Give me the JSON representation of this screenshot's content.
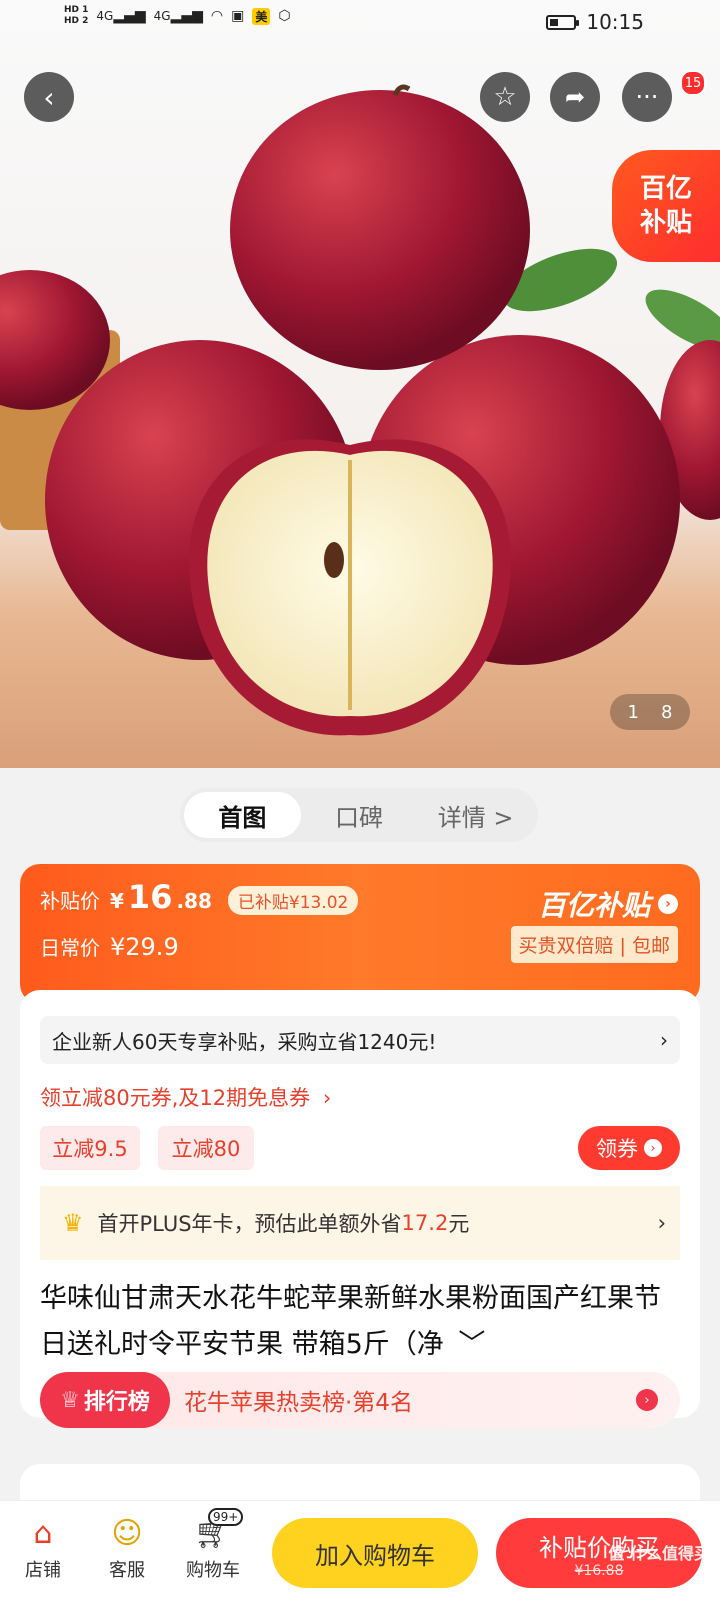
{
  "status_bar": {
    "time": "10:15",
    "hd1": "HD 1",
    "hd2": "HD 2",
    "net1": "4G",
    "net2": "4G",
    "app_badge": "美",
    "battery_level": 0.35
  },
  "hero": {
    "page_current": "1",
    "page_total": "8",
    "cart_count_badge": "15",
    "subsidy_tag_line1": "百亿",
    "subsidy_tag_line2": "补贴"
  },
  "tabs": [
    {
      "label": "首图",
      "active": true
    },
    {
      "label": "口碑",
      "active": false
    },
    {
      "label": "详情 >",
      "active": false
    }
  ],
  "price": {
    "subsidy_label": "补贴价",
    "currency": "¥",
    "subsidy_price_int": "16",
    "subsidy_price_dec": ".88",
    "saved_text": "已补贴¥13.02",
    "regular_label": "日常价",
    "regular_price": "¥29.9",
    "brand": "百亿补贴",
    "guarantee": "买贵双倍赔 | 包邮"
  },
  "promo": {
    "enterprise_banner": "企业新人60天专享补贴，采购立省1240元!",
    "coupon_line": "领立减80元券,及12期免息券",
    "chips": [
      "立减9.5",
      "立减80"
    ],
    "claim_button": "领券",
    "plus_text_prefix": "首开PLUS年卡，预估此单额外省",
    "plus_amount": "17.2",
    "plus_unit": "元"
  },
  "product": {
    "title": "华味仙甘肃天水花牛蛇苹果新鲜水果粉面国产红果节日送礼时令平安节果 带箱5斤（净"
  },
  "ranking": {
    "badge": "排行榜",
    "text": "花牛苹果热卖榜·第4名"
  },
  "bottom_bar": {
    "store": "店铺",
    "service": "客服",
    "cart": "购物车",
    "cart_badge": "99+",
    "add_to_cart": "加入购物车",
    "buy_label": "补贴价购买",
    "buy_price": "¥16.88",
    "watermark": "值 什么值得买"
  },
  "colors": {
    "accent": "#ff5b1c",
    "buy_red": "#ff3b3b",
    "cart_yellow": "#ffd21f"
  }
}
